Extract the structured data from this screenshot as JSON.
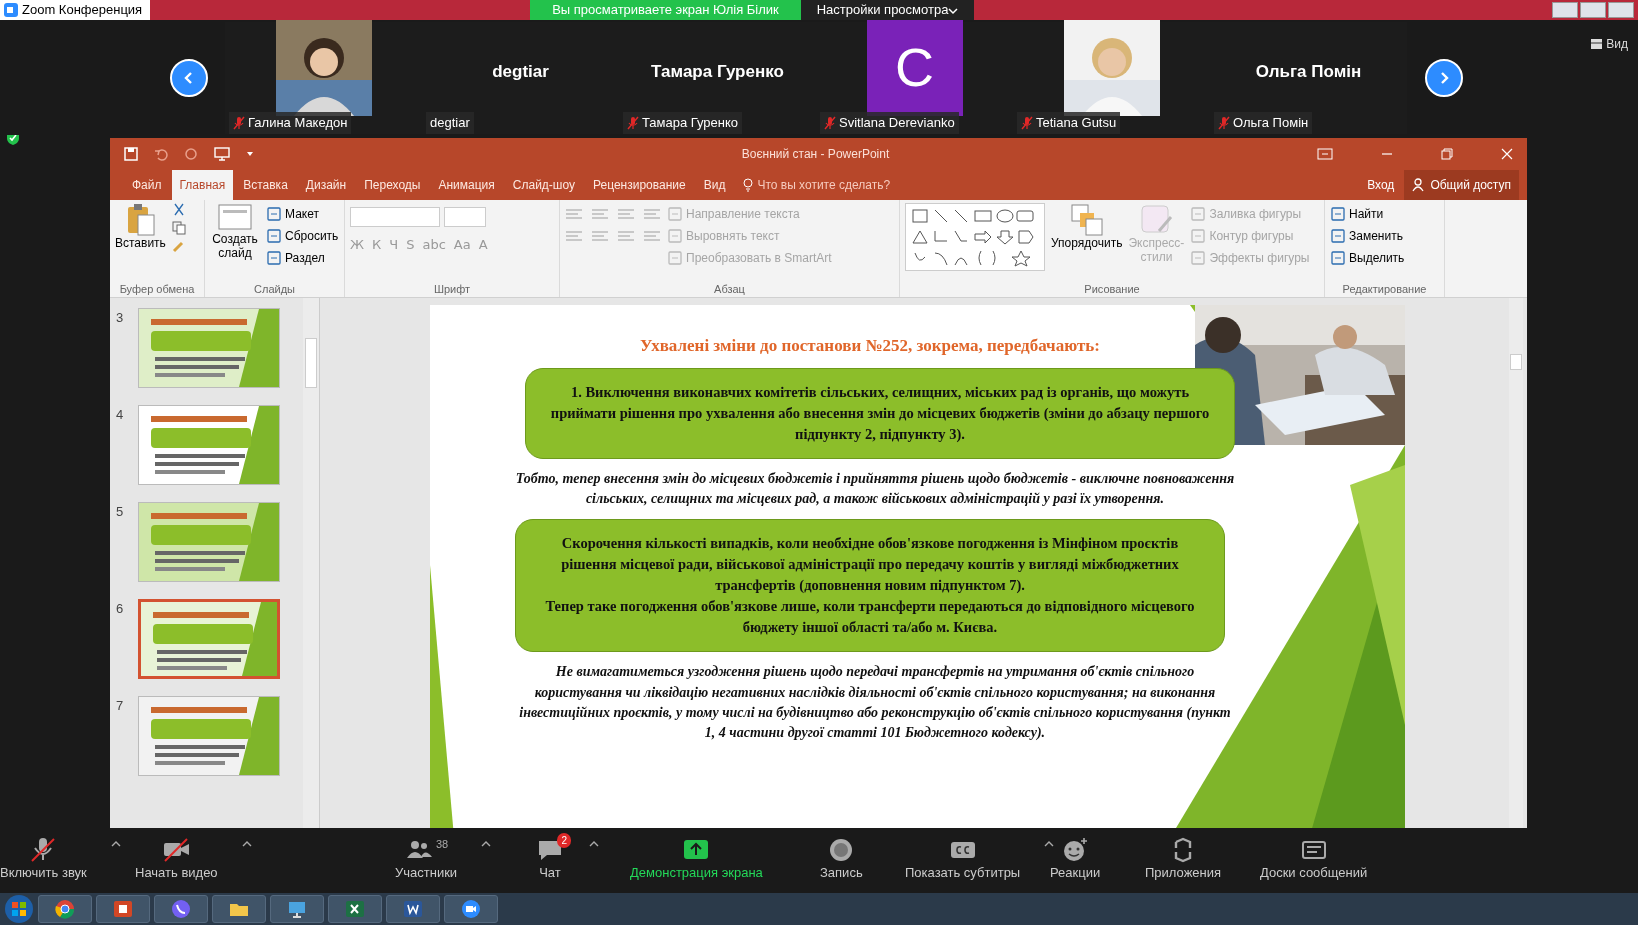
{
  "window": {
    "title": "Zoom Конференция"
  },
  "share_banner": {
    "text": "Вы просматриваете экран Юлія Білик"
  },
  "view_options": {
    "label": "Настройки просмотра"
  },
  "view_button": {
    "label": "Вид"
  },
  "participants": [
    {
      "name": "Галина Македон",
      "muted": true
    },
    {
      "kind": "name",
      "display": "degtiar",
      "name": "degtiar",
      "muted": false
    },
    {
      "kind": "name",
      "display": "Тамара Гуренко",
      "name": "Тамара Гуренко",
      "muted": true
    },
    {
      "kind": "avatar",
      "letter": "C",
      "color": "#7a22b8",
      "name": "Svitlana Derevianko",
      "muted": true
    },
    {
      "name": "Tetiana Gutsu",
      "muted": true
    },
    {
      "kind": "name",
      "display": "Ольга Помін",
      "name": "Ольга Помін",
      "muted": true
    }
  ],
  "powerpoint": {
    "title": "Воєнний стан - PowerPoint",
    "tell_me": "Что вы хотите сделать?",
    "sign_in": "Вход",
    "share": "Общий доступ",
    "tabs": [
      {
        "label": "Файл",
        "selected": false
      },
      {
        "label": "Главная",
        "selected": true
      },
      {
        "label": "Вставка",
        "selected": false
      },
      {
        "label": "Дизайн",
        "selected": false
      },
      {
        "label": "Переходы",
        "selected": false
      },
      {
        "label": "Анимация",
        "selected": false
      },
      {
        "label": "Слайд-шоу",
        "selected": false
      },
      {
        "label": "Рецензирование",
        "selected": false
      },
      {
        "label": "Вид",
        "selected": false
      }
    ],
    "ribbon": {
      "clipboard": {
        "label": "Буфер обмена",
        "paste": "Вставить"
      },
      "slides": {
        "label": "Слайды",
        "new_slide": "Создать слайд",
        "items": [
          "Макет",
          "Сбросить",
          "Раздел"
        ]
      },
      "font": {
        "label": "Шрифт",
        "buttons": [
          "Ж",
          "К",
          "Ч",
          "S",
          "abc",
          "Aa",
          "A"
        ]
      },
      "paragraph": {
        "label": "Абзац",
        "items": [
          {
            "label": "Направление текста",
            "disabled": true
          },
          {
            "label": "Выровнять текст",
            "disabled": true
          },
          {
            "label": "Преобразовать в SmartArt",
            "disabled": true
          }
        ]
      },
      "drawing": {
        "label": "Рисование",
        "arrange": "Упорядочить",
        "styles": "Экспресс-стили",
        "items": [
          {
            "label": "Заливка фигуры",
            "disabled": true
          },
          {
            "label": "Контур фигуры",
            "disabled": true
          },
          {
            "label": "Эффекты фигуры",
            "disabled": true
          }
        ]
      },
      "editing": {
        "label": "Редактирование",
        "items": [
          {
            "label": "Найти",
            "disabled": false
          },
          {
            "label": "Заменить",
            "disabled": false
          },
          {
            "label": "Выделить",
            "disabled": false
          }
        ]
      }
    }
  },
  "slides": [
    {
      "number": "3",
      "selected": false
    },
    {
      "number": "4",
      "selected": false
    },
    {
      "number": "5",
      "selected": false
    },
    {
      "number": "6",
      "selected": true
    },
    {
      "number": "7",
      "selected": false
    }
  ],
  "slide": {
    "title": "Ухвалені зміни до постанови №252, зокрема, передбачають:",
    "box_1": [
      "1. Виключення виконавчих комітетів сільських, селищних, міських рад із органів,  що можуть приймати рішення про ухвалення або внесення змін до місцевих бюджетів (зміни до абзацу першого підпункту 2, підпункту 3)."
    ],
    "note_1": "Тобто, тепер внесення змін до місцевих бюджетів і прийняття рішень щодо бюджетів - виключне повноваження сільських, селищних та місцевих рад, а також військових адміністрацій у разі їх утворення.",
    "box_2": [
      "Скорочення кількості випадків, коли необхідне обов'язкове погодження із Мінфіном проєктів рішення місцевої ради, військової адміністрації про передачу коштів у вигляді міжбюджетних трансфертів (доповнення новим підпунктом 7).",
      "Тепер таке погодження обов'язкове лише, коли трансферти передаються до відповідного місцевого бюджету іншої області та/або м. Києва."
    ],
    "note_2": "Не вимагатиметься узгодження рішень щодо передачі трансфертів на утримання об'єктів спільного користування чи ліквідацію негативних наслідків діяльності об'єктів спільного користування; на виконання інвестиційних проєктів, у тому числі на будівництво або реконструкцію об'єктів спільного користування (пункт 1, 4 частини другої статті 101 Бюджетного кодексу)."
  },
  "toolbar": [
    {
      "kind": "mic",
      "label": "Включить звук",
      "crossed": true,
      "menu": true,
      "highlighted": false
    },
    {
      "kind": "video",
      "label": "Начать видео",
      "crossed": true,
      "menu": true,
      "highlighted": false
    },
    {
      "kind": "participants",
      "label": "Участники",
      "count": "38",
      "crossed": false,
      "menu": true,
      "highlighted": false
    },
    {
      "kind": "chat",
      "label": "Чат",
      "badge": "2",
      "crossed": false,
      "menu": true,
      "highlighted": false
    },
    {
      "kind": "share",
      "label": "Демонстрация экрана",
      "crossed": false,
      "menu": false,
      "highlighted": true
    },
    {
      "kind": "record",
      "label": "Запись",
      "crossed": false,
      "menu": false,
      "highlighted": false
    },
    {
      "kind": "cc",
      "label": "Показать субтитры",
      "crossed": false,
      "menu": true,
      "highlighted": false
    },
    {
      "kind": "reactions",
      "label": "Реакции",
      "crossed": false,
      "menu": false,
      "highlighted": false
    },
    {
      "kind": "apps",
      "label": "Приложения",
      "crossed": false,
      "menu": false,
      "highlighted": false
    },
    {
      "kind": "boards",
      "label": "Доски сообщений",
      "crossed": false,
      "menu": false,
      "highlighted": false
    }
  ]
}
